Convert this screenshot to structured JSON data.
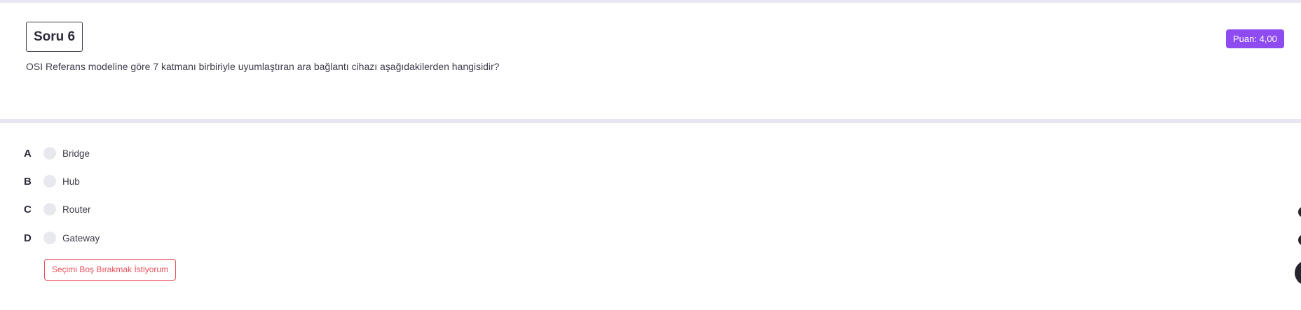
{
  "question": {
    "number_label": "Soru 6",
    "score_label": "Puan: 4,00",
    "text": "OSI Referans modeline göre 7 katmanı birbiriyle uyumlaştıran ara bağlantı cihazı aşağıdakilerden hangisidir?"
  },
  "options": [
    {
      "letter": "A",
      "label": "Bridge",
      "selected": false
    },
    {
      "letter": "B",
      "label": "Hub",
      "selected": false
    },
    {
      "letter": "C",
      "label": "Router",
      "selected": false
    },
    {
      "letter": "D",
      "label": "Gateway",
      "selected": false
    }
  ],
  "actions": {
    "skip_label": "Seçimi Boş Bırakmak İstiyorum"
  },
  "colors": {
    "accent": "#8e4cf0",
    "danger": "#e8505b",
    "radio": "#e8e8ef"
  }
}
